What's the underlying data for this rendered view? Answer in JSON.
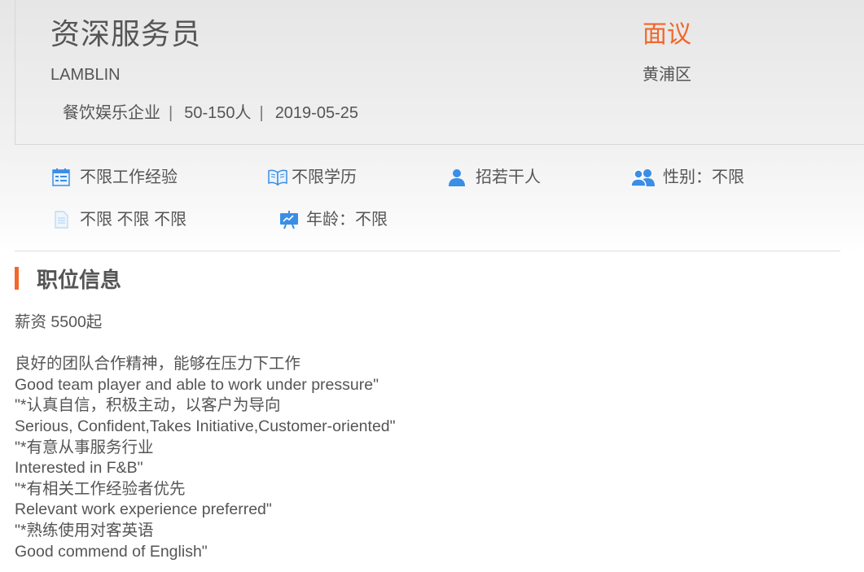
{
  "job": {
    "title": "资深服务员",
    "company": "LAMBLIN",
    "industry": "餐饮娱乐企业",
    "size": "50-150人",
    "date": "2019-05-25",
    "separator": "|",
    "salary": "面议",
    "district": "黄浦区"
  },
  "requirements": {
    "experience": "不限工作经验",
    "education": "不限学历",
    "headcount": "招若干人",
    "gender": "性别：不限",
    "misc": "不限 不限 不限",
    "age": "年龄：不限"
  },
  "icons": {
    "experience": "calendar-icon",
    "education": "open-book-icon",
    "headcount": "person-icon",
    "gender": "people-icon",
    "misc": "document-icon",
    "age": "presentation-board-icon"
  },
  "colors": {
    "accent": "#f2672a",
    "icon_blue": "#3a8ee6",
    "text": "#555555"
  },
  "section": {
    "title": "职位信息"
  },
  "description": {
    "salary_line": "薪资 5500起",
    "lines": [
      "良好的团队合作精神，能够在压力下工作",
      "Good team player and able to work under pressure\"",
      "\"*认真自信，积极主动，以客户为导向",
      "Serious, Confident,Takes Initiative,Customer-oriented\"",
      "\"*有意从事服务行业",
      "Interested in F&B\"",
      "\"*有相关工作经验者优先",
      "Relevant work experience preferred\"",
      "\"*熟练使用对客英语",
      "Good commend of English\""
    ]
  }
}
